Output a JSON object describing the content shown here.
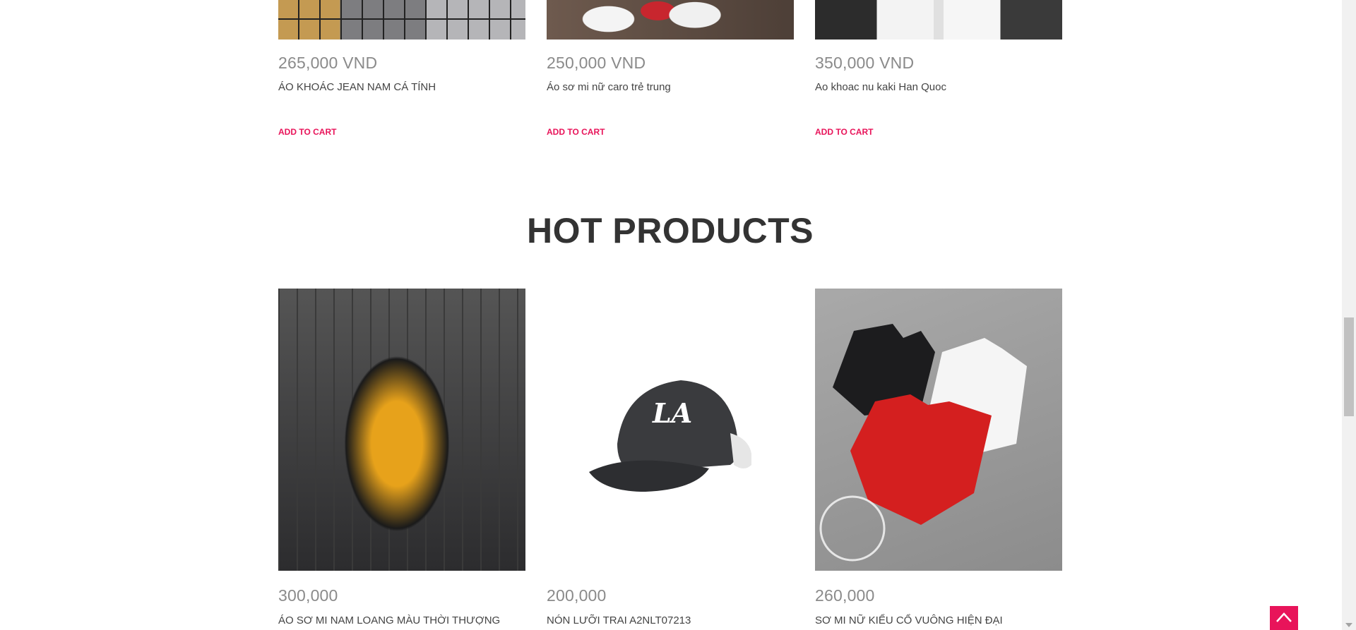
{
  "top_products": [
    {
      "price": "265,000 VND",
      "name": "ÁO KHOÁC JEAN NAM CÁ TÍNH",
      "add_to_cart_label": "ADD TO CART",
      "image_icon": "jacket-image"
    },
    {
      "price": "250,000 VND",
      "name": "Áo sơ mi nữ caro trẻ trung",
      "add_to_cart_label": "ADD TO CART",
      "image_icon": "shoes-image"
    },
    {
      "price": "350,000 VND",
      "name": "Ao khoac nu kaki Han Quoc",
      "add_to_cart_label": "ADD TO CART",
      "image_icon": "pants-image"
    }
  ],
  "hot_products": {
    "title": "HOT PRODUCTS",
    "items": [
      {
        "price": "300,000",
        "name": "ÁO SƠ MI NAM LOANG MÀU THỜI THƯỢNG",
        "image_icon": "shirt-image"
      },
      {
        "price": "200,000",
        "name": "NÓN LƯỠI TRAI A2NLT07213",
        "image_icon": "cap-image"
      },
      {
        "price": "260,000",
        "name": "SƠ MI NỮ KIỂU CỔ VUÔNG HIỆN ĐẠI",
        "image_icon": "tops-image"
      }
    ]
  },
  "colors": {
    "accent": "#e8145a",
    "price": "#8a8a8a",
    "title": "#333333"
  },
  "back_to_top_icon": "chevron-up-icon"
}
